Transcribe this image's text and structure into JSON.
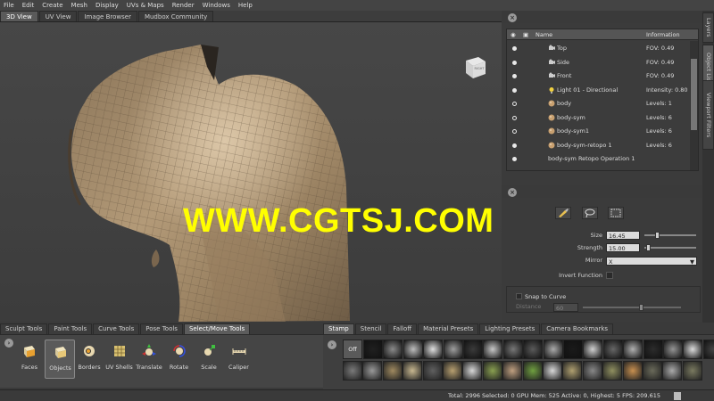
{
  "menu": [
    "File",
    "Edit",
    "Create",
    "Mesh",
    "Display",
    "UVs & Maps",
    "Render",
    "Windows",
    "Help"
  ],
  "viewport_tabs": [
    {
      "label": "3D View",
      "active": true
    },
    {
      "label": "UV View",
      "active": false
    },
    {
      "label": "Image Browser",
      "active": false
    },
    {
      "label": "Mudbox Community",
      "active": false
    }
  ],
  "viewcube_label": "RIGHT",
  "watermark": "WWW.CGTSJ.COM",
  "side_tabs": [
    "Layers",
    "Object List",
    "Viewport Filters"
  ],
  "object_list": {
    "col_name": "Name",
    "col_info": "Information",
    "rows": [
      {
        "name": "Top",
        "info": "FOV: 0.49",
        "icon": "camera-icon",
        "dot": "filled"
      },
      {
        "name": "Side",
        "info": "FOV: 0.49",
        "icon": "camera-icon",
        "dot": "filled"
      },
      {
        "name": "Front",
        "info": "FOV: 0.49",
        "icon": "camera-icon",
        "dot": "filled"
      },
      {
        "name": "Light 01 - Directional",
        "info": "Intensity: 0.80",
        "icon": "light-icon",
        "dot": "filled"
      },
      {
        "name": "body",
        "info": "Levels: 1",
        "icon": "mesh-icon",
        "dot": "hollow"
      },
      {
        "name": "body-sym",
        "info": "Levels: 6",
        "icon": "mesh-icon",
        "dot": "hollow"
      },
      {
        "name": "body-sym1",
        "info": "Levels: 6",
        "icon": "mesh-icon",
        "dot": "hollow"
      },
      {
        "name": "body-sym-retopo 1",
        "info": "Levels: 6",
        "icon": "mesh-icon",
        "dot": "filled"
      },
      {
        "name": "body-sym Retopo Operation 1",
        "info": "",
        "icon": "",
        "dot": "filled"
      }
    ]
  },
  "properties": {
    "size_label": "Size",
    "size_value": "16.45",
    "size_level": 0.25,
    "strength_label": "Strength",
    "strength_value": "15.00",
    "strength_level": 0.08,
    "mirror_label": "Mirror",
    "mirror_value": "X",
    "invert_label": "Invert Function",
    "snap_label": "Snap to Curve",
    "distance_label": "Distance",
    "distance_value": "60",
    "distance_level": 0.6
  },
  "tool_tabs": [
    {
      "label": "Sculpt Tools",
      "active": false
    },
    {
      "label": "Paint Tools",
      "active": false
    },
    {
      "label": "Curve Tools",
      "active": false
    },
    {
      "label": "Pose Tools",
      "active": false
    },
    {
      "label": "Select/Move Tools",
      "active": true
    }
  ],
  "tools": [
    {
      "label": "Faces",
      "icon": "faces-icon",
      "active": false
    },
    {
      "label": "Objects",
      "icon": "objects-icon",
      "active": true
    },
    {
      "label": "Borders",
      "icon": "borders-icon",
      "active": false
    },
    {
      "label": "UV Shells",
      "icon": "uv-shells-icon",
      "active": false
    },
    {
      "label": "Translate",
      "icon": "translate-icon",
      "active": false
    },
    {
      "label": "Rotate",
      "icon": "rotate-icon",
      "active": false
    },
    {
      "label": "Scale",
      "icon": "scale-icon",
      "active": false
    },
    {
      "label": "Caliper",
      "icon": "caliper-icon",
      "active": false
    }
  ],
  "stamp_tabs": [
    {
      "label": "Stamp",
      "active": true
    },
    {
      "label": "Stencil",
      "active": false
    },
    {
      "label": "Falloff",
      "active": false
    },
    {
      "label": "Material Presets",
      "active": false
    },
    {
      "label": "Lighting Presets",
      "active": false
    },
    {
      "label": "Camera Bookmarks",
      "active": false
    }
  ],
  "stamp_off_label": "Off",
  "status_text": "Total: 2996  Selected: 0 GPU Mem: 525  Active: 0, Highest: 5  FPS: 209.615",
  "colors": {
    "skin": "#a08868",
    "watermark": "#ffff00",
    "panel": "#3b3b3b"
  }
}
